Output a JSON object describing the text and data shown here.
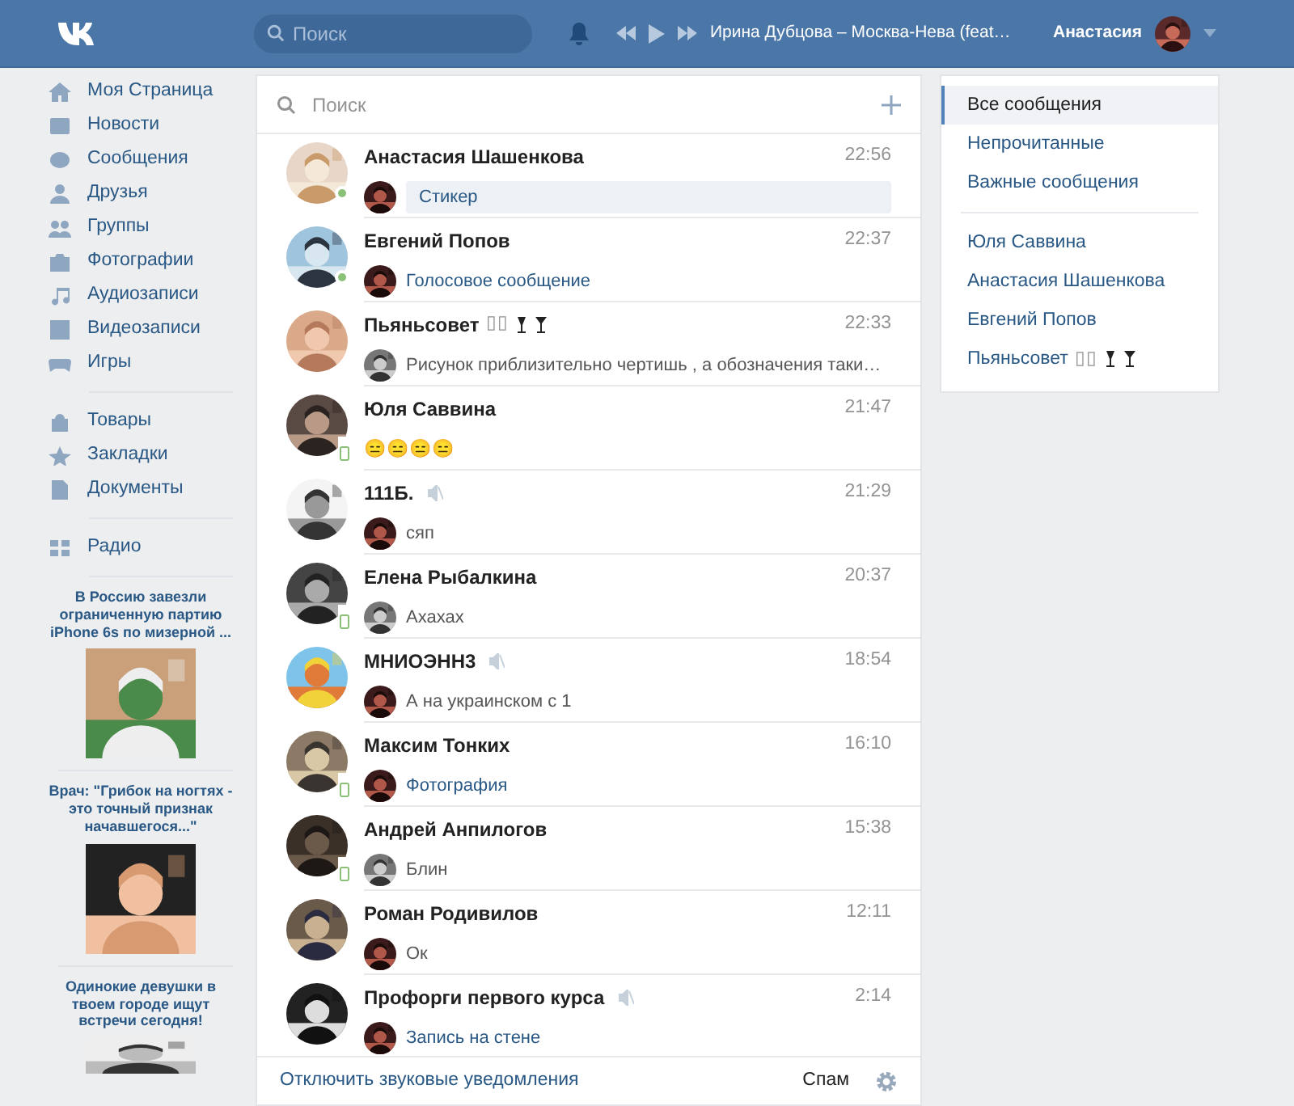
{
  "header": {
    "search_placeholder": "Поиск",
    "track": "Ирина Дубцова – Москва-Нева (feat…",
    "user_name": "Анастасия"
  },
  "nav": [
    [
      {
        "label": "Моя Страница"
      },
      {
        "label": "Новости"
      },
      {
        "label": "Сообщения"
      },
      {
        "label": "Друзья"
      },
      {
        "label": "Группы"
      },
      {
        "label": "Фотографии"
      },
      {
        "label": "Аудиозаписи"
      },
      {
        "label": "Видеозаписи"
      },
      {
        "label": "Игры"
      }
    ],
    [
      {
        "label": "Товары"
      },
      {
        "label": "Закладки"
      },
      {
        "label": "Документы"
      }
    ],
    [
      {
        "label": "Радио"
      }
    ]
  ],
  "ads": [
    {
      "title": "В Россию завезли ограниченную партию iPhone 6s по мизерной ...",
      "kind": "picture"
    },
    {
      "title": "Врач: \"Грибок на ногтях - это точный признак начавшегося...\"",
      "kind": "picture"
    },
    {
      "title": "Одинокие девушки в твоем городе ищут встречи сегодня!",
      "kind": "picture"
    }
  ],
  "dialogs": {
    "search_placeholder": "Поиск",
    "items": [
      {
        "name": "Анастасия Шашенкова",
        "time": "22:56",
        "online": true,
        "mobile": false,
        "muted": false,
        "sender_avatar": true,
        "preview": "Стикер",
        "attachment": true,
        "unread": true
      },
      {
        "name": "Евгений Попов",
        "time": "22:37",
        "online": true,
        "mobile": false,
        "muted": false,
        "sender_avatar": true,
        "preview": "Голосовое сообщение",
        "attachment": true,
        "unread": false
      },
      {
        "name": "Пьяньсовет",
        "name_suffix": "▯▯",
        "time": "22:33",
        "online": false,
        "mobile": false,
        "muted": false,
        "sender_avatar": true,
        "preview": "Рисунок приблизительно чертишь , а обозначения таки…",
        "attachment": false,
        "unread": false
      },
      {
        "name": "Юля Саввина",
        "time": "21:47",
        "online": false,
        "mobile": true,
        "muted": false,
        "sender_avatar": false,
        "preview": "😑😑😑😑",
        "attachment": false,
        "unread": false
      },
      {
        "name": "111Б.",
        "time": "21:29",
        "online": false,
        "mobile": false,
        "muted": true,
        "sender_avatar": true,
        "preview": "сяп",
        "attachment": false,
        "unread": false
      },
      {
        "name": "Елена Рыбалкина",
        "time": "20:37",
        "online": false,
        "mobile": true,
        "muted": false,
        "sender_avatar": true,
        "preview": "Ахахах",
        "attachment": false,
        "unread": false
      },
      {
        "name": "МНИОЭНН3",
        "time": "18:54",
        "online": false,
        "mobile": false,
        "muted": true,
        "sender_avatar": true,
        "preview": "А на украинском с 1",
        "attachment": false,
        "unread": false
      },
      {
        "name": "Максим Тонких",
        "time": "16:10",
        "online": false,
        "mobile": true,
        "muted": false,
        "sender_avatar": true,
        "preview": "Фотография",
        "attachment": true,
        "unread": false
      },
      {
        "name": "Андрей Анпилогов",
        "time": "15:38",
        "online": false,
        "mobile": true,
        "muted": false,
        "sender_avatar": true,
        "preview": "Блин",
        "attachment": false,
        "unread": false
      },
      {
        "name": "Роман Родивилов",
        "time": "12:11",
        "online": false,
        "mobile": false,
        "muted": false,
        "sender_avatar": true,
        "preview": "Ок",
        "attachment": false,
        "unread": false
      },
      {
        "name": "Профорги первого курса",
        "time": "2:14",
        "online": false,
        "mobile": false,
        "muted": true,
        "sender_avatar": true,
        "preview": "Запись на стене",
        "attachment": true,
        "unread": false
      }
    ],
    "footer_link": "Отключить звуковые уведомления",
    "spam": "Спам"
  },
  "filters": [
    {
      "label": "Все сообщения",
      "selected": true
    },
    {
      "label": "Непрочитанные",
      "selected": false
    },
    {
      "label": "Важные сообщения",
      "selected": false
    }
  ],
  "pinned": [
    {
      "name": "Юля Саввина"
    },
    {
      "name": "Анастасия Шашенкова"
    },
    {
      "name": "Евгений Попов"
    },
    {
      "name": "Пьяньсовет",
      "name_suffix": "▯▯"
    }
  ]
}
